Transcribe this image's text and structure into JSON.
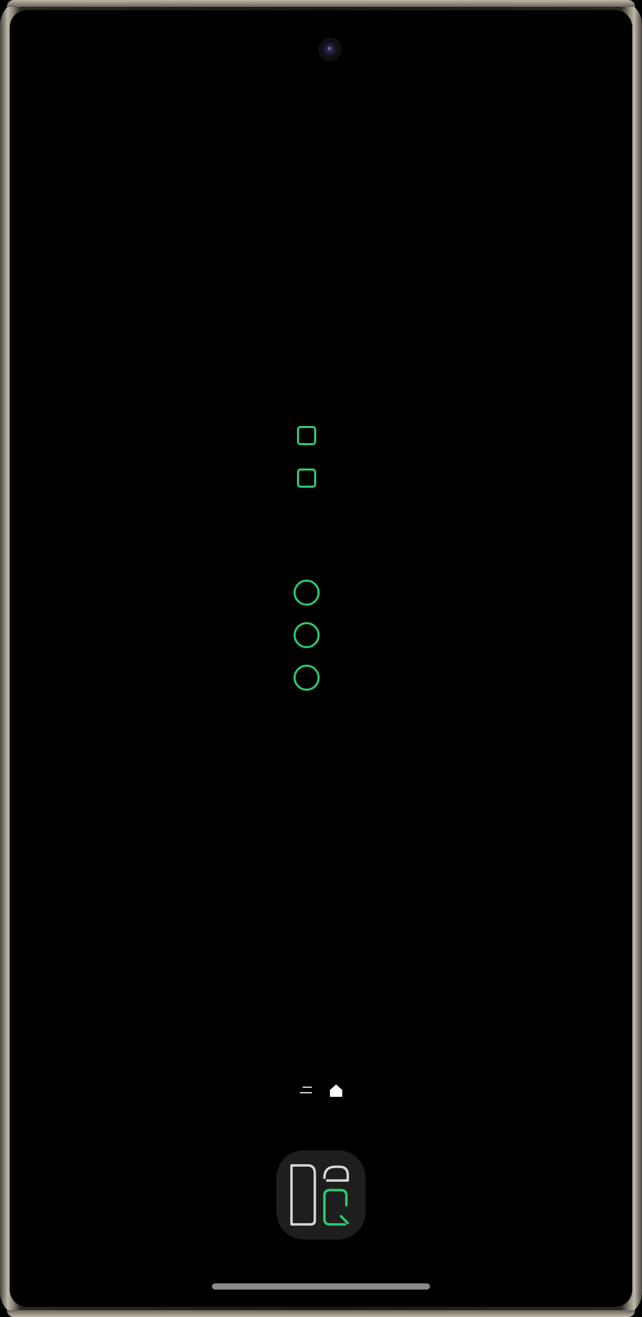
{
  "device": {
    "screen_background": "#000000",
    "frame_color": "#bdb7a8"
  },
  "content": {
    "accent_color": "#2ecc71",
    "shapes": [
      {
        "kind": "rounded-square",
        "icon": "square-outline-icon"
      },
      {
        "kind": "rounded-square",
        "icon": "square-outline-icon"
      },
      {
        "kind": "circle",
        "icon": "circle-outline-icon"
      },
      {
        "kind": "circle",
        "icon": "circle-outline-icon"
      },
      {
        "kind": "circle",
        "icon": "circle-outline-icon"
      }
    ]
  },
  "bottom_bar": {
    "left_icon": "menu-lines-icon",
    "right_icon": "home-icon"
  },
  "app": {
    "icon": "app-logo-icon",
    "logo_colors": {
      "outline": "#d9d9d9",
      "accent": "#2ecc71"
    }
  },
  "system": {
    "gesture_bar": "gesture-handle"
  }
}
